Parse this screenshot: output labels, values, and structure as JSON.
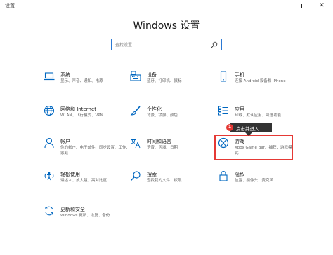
{
  "window": {
    "app_title": "设置",
    "minimize_glyph": "—",
    "close_glyph": "✕"
  },
  "header": {
    "title": "Windows 设置"
  },
  "search": {
    "placeholder": "查找设置"
  },
  "tiles": [
    {
      "title": "系统",
      "desc": "显示、声音、通知、电源",
      "icon": "laptop-icon"
    },
    {
      "title": "设备",
      "desc": "蓝牙、打印机、鼠标",
      "icon": "keyboard-icon"
    },
    {
      "title": "手机",
      "desc": "连接 Android 设备和 iPhone",
      "icon": "phone-icon"
    },
    {
      "title": "网络和 Internet",
      "desc": "WLAN、飞行模式、VPN",
      "icon": "globe-icon"
    },
    {
      "title": "个性化",
      "desc": "背景、锁屏、颜色",
      "icon": "paintbrush-icon"
    },
    {
      "title": "应用",
      "desc": "卸载、默认应用、可选功能",
      "icon": "apps-list-icon"
    },
    {
      "title": "帐户",
      "desc": "你的帐户、电子邮件、同步设置、工作、家庭",
      "icon": "person-icon"
    },
    {
      "title": "时间和语言",
      "desc": "语音、区域、日期",
      "icon": "time-language-icon"
    },
    {
      "title": "游戏",
      "desc": "Xbox Game Bar、捕获、游戏模式",
      "icon": "xbox-icon"
    },
    {
      "title": "轻松使用",
      "desc": "讲述人、放大镜、高对比度",
      "icon": "ease-of-access-icon"
    },
    {
      "title": "搜索",
      "desc": "查找我的文件、权限",
      "icon": "search-icon"
    },
    {
      "title": "隐私",
      "desc": "位置、摄像头、麦克风",
      "icon": "lock-icon"
    },
    {
      "title": "更新和安全",
      "desc": "Windows 更新、恢复、备份",
      "icon": "sync-icon"
    }
  ],
  "callout": {
    "badge": "1",
    "text": "点击并进入"
  },
  "colors": {
    "accent": "#0067c0",
    "highlight": "#e53935",
    "search_border": "#2b79d4"
  }
}
